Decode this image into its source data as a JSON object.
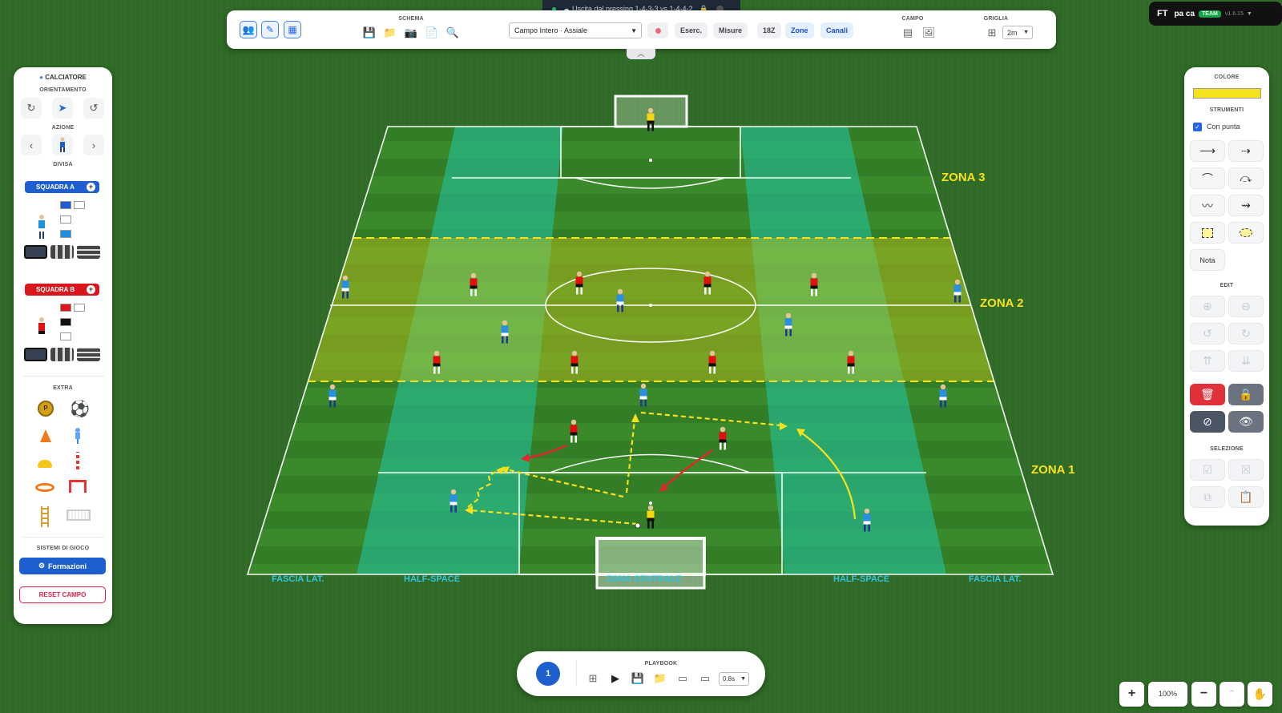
{
  "top_banner": {
    "text": "Uscita dal pressing 1-4-3-3 vs 1-4-4-2"
  },
  "toolbar": {
    "schema_label": "SCHEMA",
    "campo_label": "CAMPO",
    "griglia_label": "GRIGLIA",
    "field_select": "Campo Intero · Assiale",
    "buttons": [
      "Eserc.",
      "Misure",
      "18Z",
      "Zone",
      "Canali"
    ],
    "grid_select": "2m"
  },
  "brand": {
    "logo": "FT",
    "user": "pa ca",
    "badge": "TEAM",
    "version": "v1.6.15"
  },
  "left_panel": {
    "title": "CALCIATORE",
    "orientamento": "ORIENTAMENTO",
    "azione": "AZIONE",
    "divisa": "DIVISA",
    "team_a": "SQUADRA A",
    "team_b": "SQUADRA B",
    "extra": "EXTRA",
    "sistemi": "SISTEMI DI GIOCO",
    "formazioni": "Formazioni",
    "reset": "RESET CAMPO",
    "team_a_color": "#1e5fd0",
    "team_b_color": "#d9161c"
  },
  "right_panel": {
    "colore": "COLORE",
    "color_value": "#f5e11c",
    "strumenti": "STRUMENTI",
    "con_punta": "Con punta",
    "nota": "Nota",
    "edit": "EDIT",
    "selezione": "SELEZIONE"
  },
  "zones": {
    "zona3": "ZONA 3",
    "zona2": "ZONA 2",
    "zona1": "ZONA 1"
  },
  "bands": {
    "fascia_left": "FASCIA LAT.",
    "half_left": "HALF-SPACE",
    "centrale": "ZONA CENTRALE",
    "half_right": "HALF-SPACE",
    "fascia_right": "FASCIA LAT."
  },
  "playbook": {
    "label": "PLAYBOOK",
    "frame": "1",
    "speed": "0.8s"
  },
  "zoom": {
    "level": "100%"
  }
}
